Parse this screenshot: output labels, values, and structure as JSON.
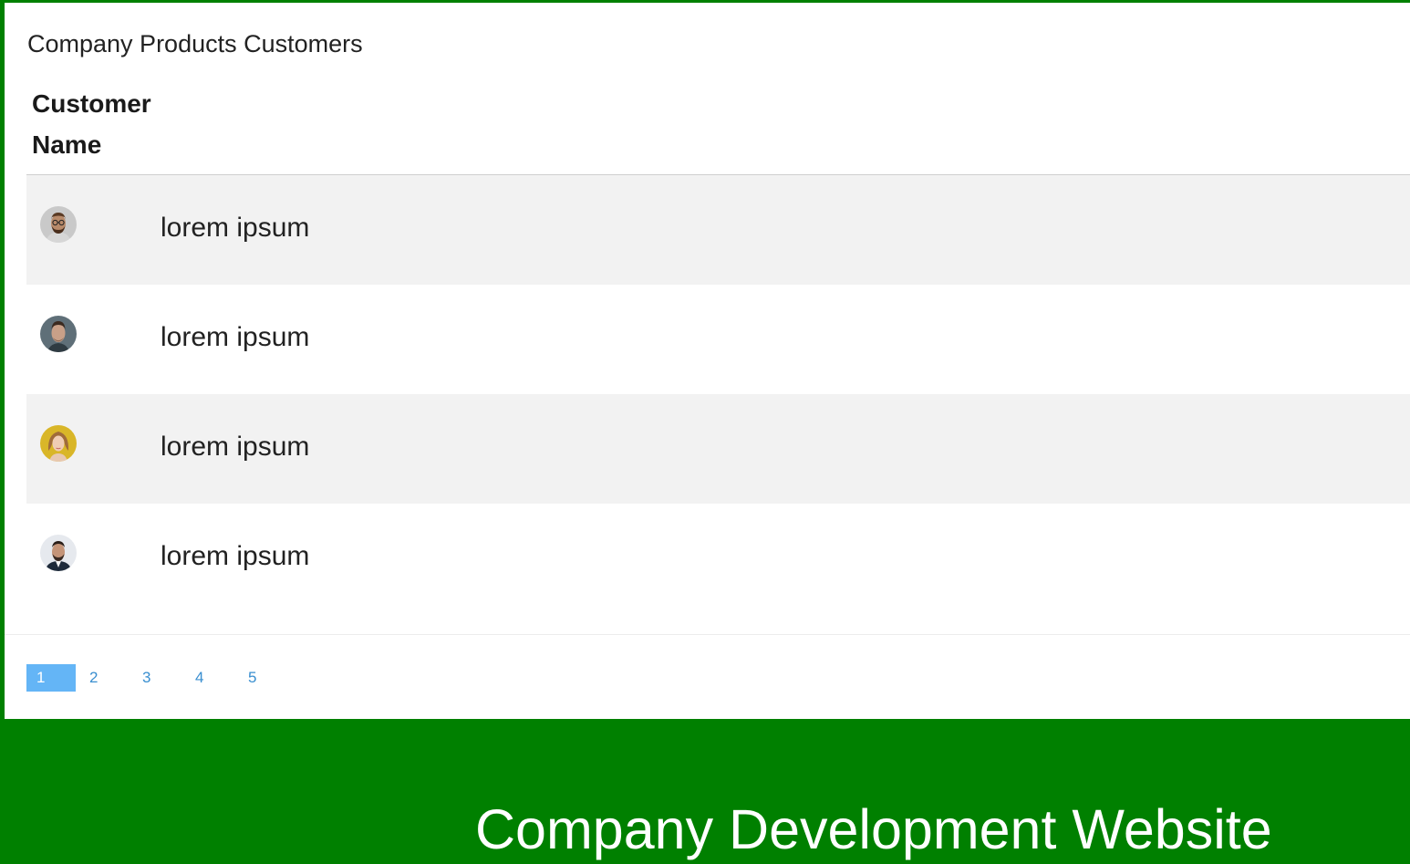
{
  "card": {
    "title": "Company Products Customers",
    "column_header": "Customer Name"
  },
  "customers": [
    {
      "name": "lorem ipsum",
      "avatar": "avatar-man-glasses-beard"
    },
    {
      "name": "lorem ipsum",
      "avatar": "avatar-man-short-hair"
    },
    {
      "name": "lorem ipsum",
      "avatar": "avatar-woman-yellow-background"
    },
    {
      "name": "lorem ipsum",
      "avatar": "avatar-man-suit-beard"
    }
  ],
  "pagination": {
    "pages": [
      "1",
      "2",
      "3",
      "4",
      "5"
    ],
    "active": "1",
    "active_color": "#64b5f6",
    "link_color": "#3a8fd0"
  },
  "footer": {
    "site_title": "Company Development Website",
    "background_color": "#008000"
  }
}
